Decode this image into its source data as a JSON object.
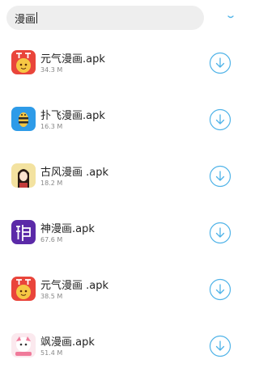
{
  "search": {
    "query": "漫画"
  },
  "colors": {
    "accent": "#4fb3e8",
    "search_bg": "#eeeeee",
    "size_text": "#888888"
  },
  "apps": [
    {
      "name": "元气漫画.apk",
      "size": "34.3 M",
      "icon": "yuanqi-manhua-app-icon"
    },
    {
      "name": "扑飞漫画.apk",
      "size": "16.3 M",
      "icon": "pufei-manhua-app-icon"
    },
    {
      "name": "古风漫画 .apk",
      "size": "18.2 M",
      "icon": "gufeng-manhua-app-icon"
    },
    {
      "name": "神漫画.apk",
      "size": "67.6 M",
      "icon": "shen-manhua-app-icon"
    },
    {
      "name": "元气漫画 .apk",
      "size": "38.5 M",
      "icon": "yuanqi-manhua-app-icon"
    },
    {
      "name": "飒漫画.apk",
      "size": "51.4 M",
      "icon": "sa-manhua-app-icon"
    }
  ]
}
